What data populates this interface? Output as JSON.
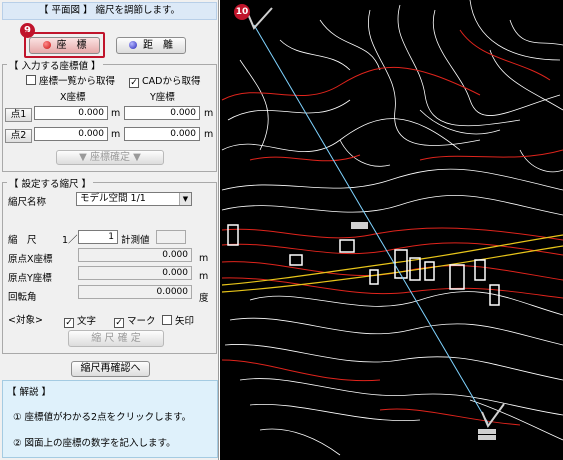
{
  "panel": {
    "title": "【 平面図 】 縮尺を調節します。",
    "badge_left": "9",
    "badge_right": "10",
    "coord_button": "座　標",
    "distance_button": "距　離",
    "input_group": {
      "title": "【 入力する座標値 】",
      "from_list": "座標一覧から取得",
      "from_cad": "CADから取得",
      "x_header": "X座標",
      "y_header": "Y座標",
      "point1": "点1",
      "point2": "点2",
      "p1x": "0.000",
      "p1y": "0.000",
      "p2x": "0.000",
      "p2y": "0.000",
      "unit": "m",
      "confirm_button": "▼ 座標確定 ▼"
    },
    "scale_group": {
      "title": "【 設定する縮尺 】",
      "name_label": "縮尺名称",
      "name_value": "モデル空間 1/1",
      "scale_label": "縮　尺",
      "scale_prefix": "1／",
      "scale_value": "1",
      "measured_label": "計測値",
      "origin_x_label": "原点X座標",
      "origin_x_value": "0.000",
      "origin_y_label": "原点Y座標",
      "origin_y_value": "0.000",
      "rotation_label": "回転角",
      "rotation_value": "0.0000",
      "unit_m": "m",
      "unit_deg": "度",
      "target_label": "<対象>",
      "target_text": "文字",
      "target_mark": "マーク",
      "target_arrow": "矢印",
      "confirm_button": "縮 尺 確 定"
    },
    "recheck_button": "縮尺再確認へ",
    "help": {
      "title": "【 解説 】",
      "step1": "① 座標値がわかる2点をクリックします。",
      "step2": "② 図面上の座標の数字を記入します。"
    }
  },
  "colors": {
    "accent": "#c0142b",
    "help_bg": "#dff1fb",
    "cad_bg": "#000000",
    "cad_red": "#e0241c",
    "cad_yellow": "#e8c51a",
    "cad_cyan": "#7fd3ff"
  }
}
